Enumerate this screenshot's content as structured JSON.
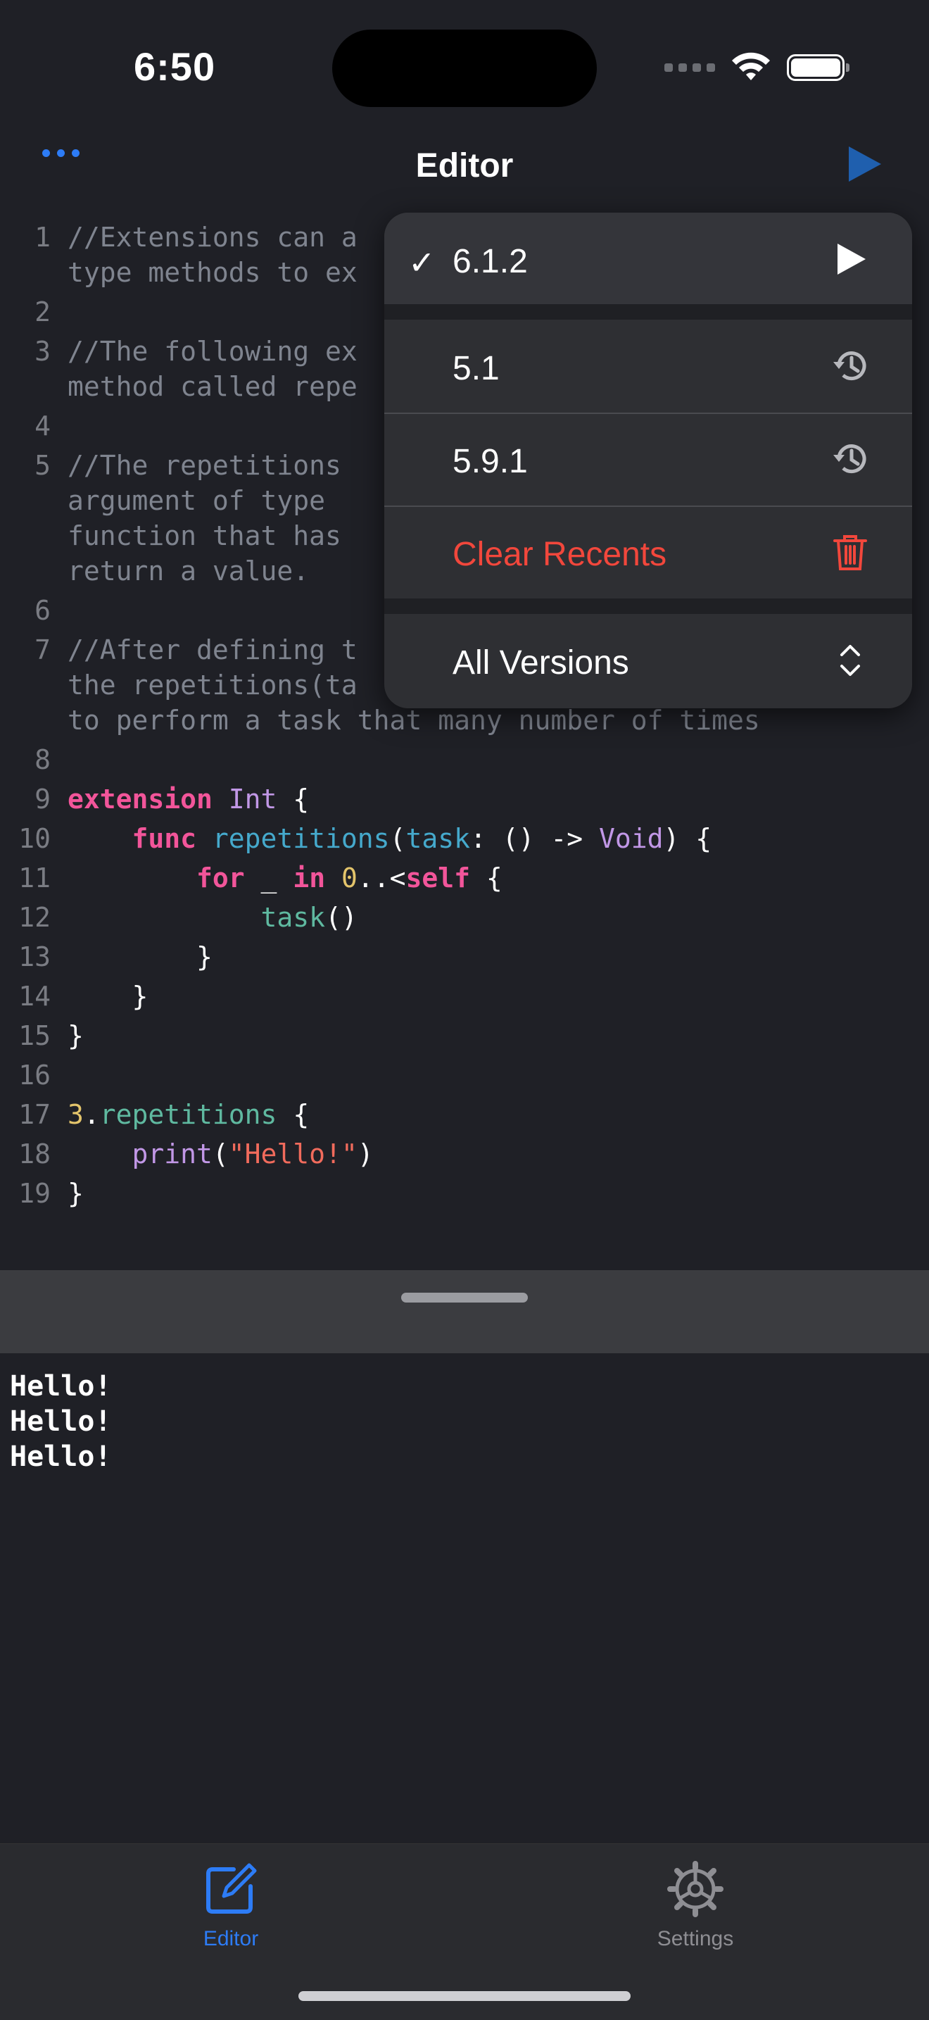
{
  "status_bar": {
    "time": "6:50"
  },
  "nav": {
    "title": "Editor"
  },
  "code_lines": [
    {
      "n": "1",
      "segments": [
        {
          "c": "cm",
          "t": "//Extensions can a"
        }
      ]
    },
    {
      "n": "",
      "segments": [
        {
          "c": "cm",
          "t": "type methods to ex"
        }
      ]
    },
    {
      "n": "2",
      "segments": []
    },
    {
      "n": "3",
      "segments": [
        {
          "c": "cm",
          "t": "//The following ex"
        }
      ]
    },
    {
      "n": "",
      "segments": [
        {
          "c": "cm",
          "t": "method called repe"
        }
      ]
    },
    {
      "n": "4",
      "segments": []
    },
    {
      "n": "5",
      "segments": [
        {
          "c": "cm",
          "t": "//The repetitions "
        }
      ]
    },
    {
      "n": "",
      "segments": [
        {
          "c": "cm",
          "t": "argument of type "
        }
      ]
    },
    {
      "n": "",
      "segments": [
        {
          "c": "cm",
          "t": "function that has "
        }
      ]
    },
    {
      "n": "",
      "segments": [
        {
          "c": "cm",
          "t": "return a value."
        }
      ]
    },
    {
      "n": "6",
      "segments": []
    },
    {
      "n": "7",
      "segments": [
        {
          "c": "cm",
          "t": "//After defining t"
        }
      ]
    },
    {
      "n": "",
      "segments": [
        {
          "c": "cm",
          "t": "the repetitions(ta"
        }
      ]
    },
    {
      "n": "",
      "segments": [
        {
          "c": "cm",
          "t": "to perform a task that many number of times"
        }
      ]
    },
    {
      "n": "8",
      "segments": []
    },
    {
      "n": "9",
      "segments": [
        {
          "c": "kw",
          "t": "extension "
        },
        {
          "c": "ty",
          "t": "Int"
        },
        {
          "c": "pl",
          "t": " {"
        }
      ]
    },
    {
      "n": "10",
      "segments": [
        {
          "c": "pl",
          "t": "    "
        },
        {
          "c": "kw",
          "t": "func "
        },
        {
          "c": "pa",
          "t": "repetitions"
        },
        {
          "c": "pl",
          "t": "("
        },
        {
          "c": "pa",
          "t": "task"
        },
        {
          "c": "pl",
          "t": ": () -> "
        },
        {
          "c": "ty",
          "t": "Void"
        },
        {
          "c": "pl",
          "t": ") {"
        }
      ]
    },
    {
      "n": "11",
      "segments": [
        {
          "c": "pl",
          "t": "        "
        },
        {
          "c": "kw",
          "t": "for"
        },
        {
          "c": "pl",
          "t": " _ "
        },
        {
          "c": "kw",
          "t": "in "
        },
        {
          "c": "nu",
          "t": "0"
        },
        {
          "c": "pl",
          "t": "..<"
        },
        {
          "c": "kw",
          "t": "self"
        },
        {
          "c": "pl",
          "t": " {"
        }
      ]
    },
    {
      "n": "12",
      "segments": [
        {
          "c": "pl",
          "t": "            "
        },
        {
          "c": "fn",
          "t": "task"
        },
        {
          "c": "pl",
          "t": "()"
        }
      ]
    },
    {
      "n": "13",
      "segments": [
        {
          "c": "pl",
          "t": "        }"
        }
      ]
    },
    {
      "n": "14",
      "segments": [
        {
          "c": "pl",
          "t": "    }"
        }
      ]
    },
    {
      "n": "15",
      "segments": [
        {
          "c": "pl",
          "t": "}"
        }
      ]
    },
    {
      "n": "16",
      "segments": []
    },
    {
      "n": "17",
      "segments": [
        {
          "c": "nu",
          "t": "3"
        },
        {
          "c": "pl",
          "t": "."
        },
        {
          "c": "fn",
          "t": "repetitions"
        },
        {
          "c": "pl",
          "t": " {"
        }
      ]
    },
    {
      "n": "18",
      "segments": [
        {
          "c": "pl",
          "t": "    "
        },
        {
          "c": "ty",
          "t": "print"
        },
        {
          "c": "pl",
          "t": "("
        },
        {
          "c": "st",
          "t": "\"Hello!\""
        },
        {
          "c": "pl",
          "t": ")"
        }
      ]
    },
    {
      "n": "19",
      "segments": [
        {
          "c": "pl",
          "t": "}"
        }
      ]
    }
  ],
  "console": {
    "lines": [
      "Hello!",
      "Hello!",
      "Hello!"
    ]
  },
  "version_menu": {
    "selected": {
      "label": "6.1.2",
      "check": "✓",
      "icon": "play-icon"
    },
    "recents": [
      {
        "label": "5.1",
        "icon": "history-icon"
      },
      {
        "label": "5.9.1",
        "icon": "history-icon"
      }
    ],
    "clear_recents": {
      "label": "Clear Recents",
      "icon": "trash-icon",
      "color": "#f2473c"
    },
    "all_versions": {
      "label": "All Versions",
      "icon": "chevron-up-down-icon"
    }
  },
  "tabs": [
    {
      "label": "Editor",
      "icon": "compose-icon",
      "active": true,
      "color": "#2d7cf6"
    },
    {
      "label": "Settings",
      "icon": "gear-icon",
      "active": false,
      "color": "#8e8e93"
    }
  ],
  "colors": {
    "accent": "#2d7cf6",
    "background": "#1f2026",
    "destructive": "#f2473c"
  }
}
